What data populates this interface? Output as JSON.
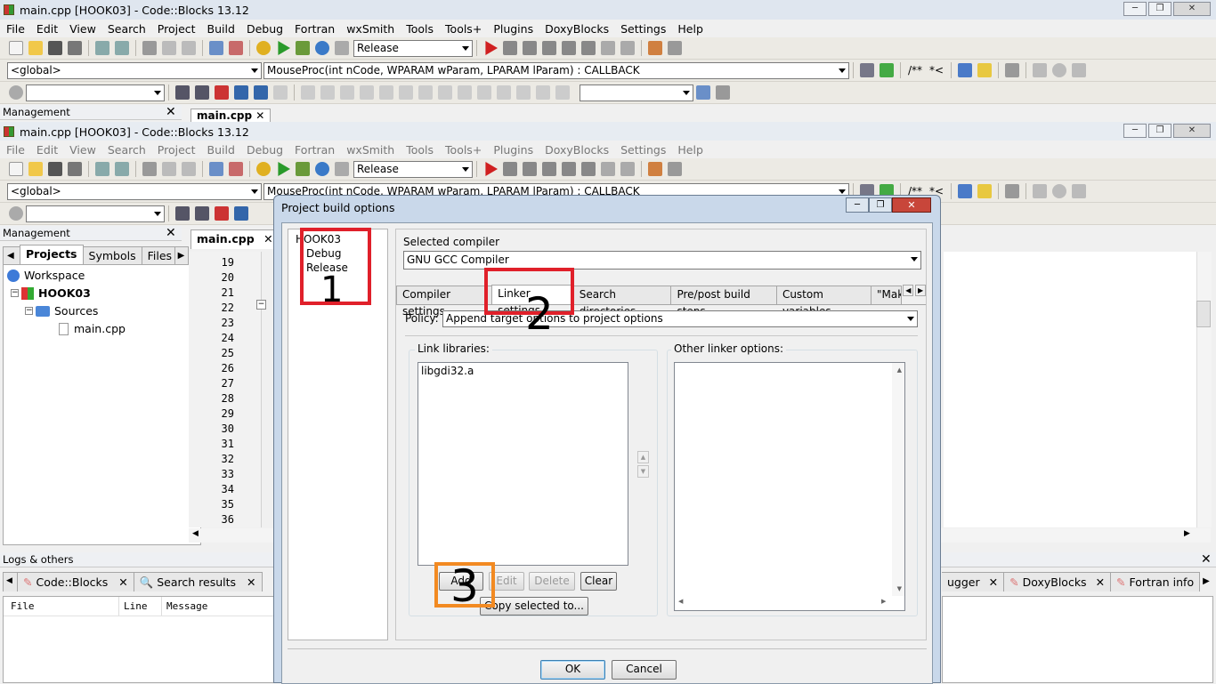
{
  "back_window": {
    "title": "main.cpp [HOOK03] - Code::Blocks 13.12"
  },
  "front_window": {
    "title": "main.cpp [HOOK03] - Code::Blocks 13.12"
  },
  "menu": [
    "File",
    "Edit",
    "View",
    "Search",
    "Project",
    "Build",
    "Debug",
    "Fortran",
    "wxSmith",
    "Tools",
    "Tools+",
    "Plugins",
    "DoxyBlocks",
    "Settings",
    "Help"
  ],
  "toolbar": {
    "build_target": "Release",
    "scope": "<global>",
    "function": "MouseProc(int nCode, WPARAM wParam, LPARAM lParam) : CALLBACK",
    "comment_block": "/**",
    "comment_line": "*<"
  },
  "management": {
    "title": "Management",
    "tabs": [
      "Projects",
      "Symbols",
      "Files"
    ],
    "tree": {
      "workspace": "Workspace",
      "project": "HOOK03",
      "folder": "Sources",
      "file": "main.cpp"
    }
  },
  "editor": {
    "tab": "main.cpp",
    "line_numbers": [
      "19",
      "20",
      "21",
      "22",
      "23",
      "24",
      "25",
      "26",
      "27",
      "28",
      "29",
      "30",
      "31",
      "32",
      "33",
      "34",
      "35",
      "36"
    ]
  },
  "logs": {
    "title": "Logs & others",
    "tabs": [
      "Code::Blocks",
      "Search results",
      "ugger",
      "DoxyBlocks",
      "Fortran info"
    ],
    "columns": [
      "File",
      "Line",
      "Message"
    ]
  },
  "dialog": {
    "title": "Project build options",
    "targets": {
      "project": "HOOK03",
      "debug": "Debug",
      "release": "Release"
    },
    "selected_compiler_label": "Selected compiler",
    "compiler": "GNU GCC Compiler",
    "tabs": [
      "Compiler settings",
      "Linker settings",
      "Search directories",
      "Pre/post build steps",
      "Custom variables",
      "\"Make"
    ],
    "policy_label": "Policy:",
    "policy": "Append target options to project options",
    "link_libraries_label": "Link libraries:",
    "link_libraries": [
      "libgdi32.a"
    ],
    "other_linker_label": "Other linker options:",
    "buttons": {
      "add": "Add",
      "edit": "Edit",
      "delete": "Delete",
      "clear": "Clear",
      "copy": "Copy selected to...",
      "ok": "OK",
      "cancel": "Cancel"
    }
  },
  "annotations": {
    "one": "1",
    "two": "2",
    "three": "3"
  }
}
